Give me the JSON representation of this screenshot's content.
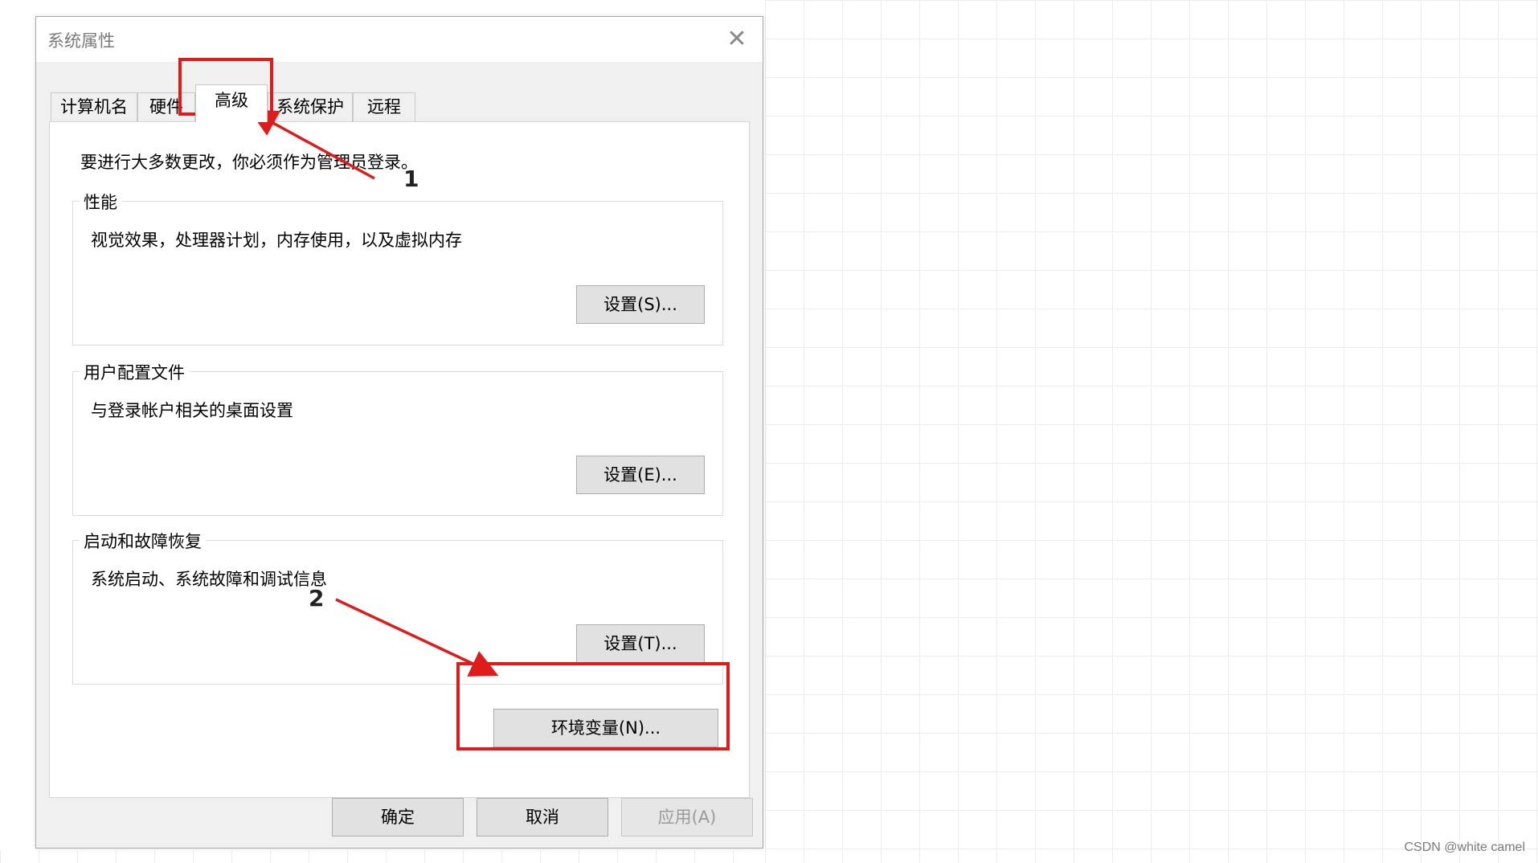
{
  "dialog": {
    "title": "系统属性",
    "close_glyph": "✕"
  },
  "tabs": [
    {
      "label": "计算机名",
      "active": false
    },
    {
      "label": "硬件",
      "active": false
    },
    {
      "label": "高级",
      "active": true
    },
    {
      "label": "系统保护",
      "active": false
    },
    {
      "label": "远程",
      "active": false
    }
  ],
  "panel": {
    "notice": "要进行大多数更改，你必须作为管理员登录。",
    "performance": {
      "title": "性能",
      "description": "视觉效果，处理器计划，内存使用，以及虚拟内存",
      "button": "设置(S)..."
    },
    "user_profiles": {
      "title": "用户配置文件",
      "description": "与登录帐户相关的桌面设置",
      "button": "设置(E)..."
    },
    "startup_recovery": {
      "title": "启动和故障恢复",
      "description": "系统启动、系统故障和调试信息",
      "button": "设置(T)..."
    },
    "env_button": "环境变量(N)..."
  },
  "footer": {
    "ok": "确定",
    "cancel": "取消",
    "apply": "应用(A)"
  },
  "annotations": {
    "step1": "1",
    "step2": "2",
    "color": "#e01b1b"
  },
  "watermark": "CSDN @white camel"
}
